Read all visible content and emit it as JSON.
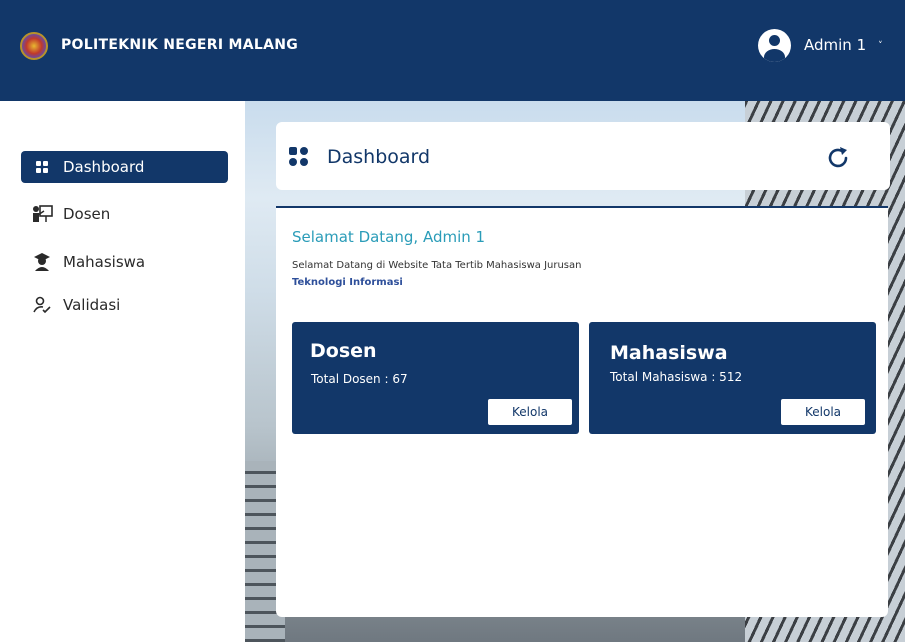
{
  "header": {
    "brand": "POLITEKNIK NEGERI MALANG",
    "user_name": "Admin 1",
    "caret": "˅"
  },
  "sidebar": {
    "items": [
      {
        "label": "Dashboard",
        "icon": "dashboard-icon",
        "active": true
      },
      {
        "label": "Dosen",
        "icon": "teacher-icon",
        "active": false
      },
      {
        "label": "Mahasiswa",
        "icon": "student-icon",
        "active": false
      },
      {
        "label": "Validasi",
        "icon": "user-check-icon",
        "active": false
      }
    ]
  },
  "page": {
    "title": "Dashboard"
  },
  "welcome": {
    "title": "Selamat Datang, Admin 1",
    "description": "Selamat Datang di Website Tata Tertib Mahasiswa Jurusan",
    "department": "Teknologi Informasi"
  },
  "stats": [
    {
      "title": "Dosen",
      "count_text": "Total Dosen : 67",
      "button": "Kelola"
    },
    {
      "title": "Mahasiswa",
      "count_text": "Total Mahasiswa : 512",
      "button": "Kelola"
    }
  ],
  "colors": {
    "primary": "#123769",
    "welcome": "#2a9cb8",
    "department": "#2e4f9a"
  }
}
